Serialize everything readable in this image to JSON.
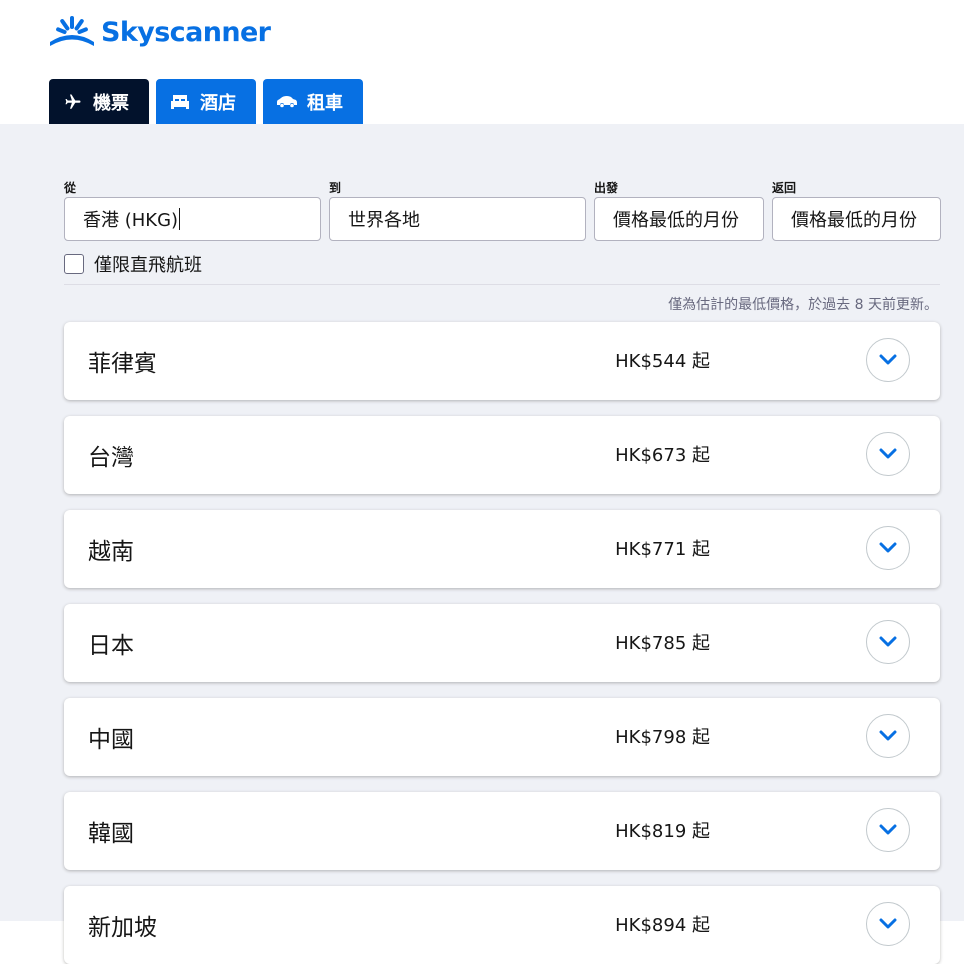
{
  "brand": {
    "name": "Skyscanner",
    "color": "#0770e3"
  },
  "tabs": [
    {
      "label": "機票",
      "icon": "airplane-icon",
      "active": true
    },
    {
      "label": "酒店",
      "icon": "bed-icon",
      "active": false
    },
    {
      "label": "租車",
      "icon": "car-icon",
      "active": false
    }
  ],
  "search": {
    "from": {
      "label": "從",
      "value": "香港 (HKG)"
    },
    "to": {
      "label": "到",
      "value": "世界各地"
    },
    "depart": {
      "label": "出發",
      "value": "價格最低的月份"
    },
    "return": {
      "label": "返回",
      "value": "價格最低的月份"
    },
    "direct_only": {
      "label": "僅限直飛航班",
      "checked": false
    }
  },
  "note": "僅為估計的最低價格，於過去 8 天前更新。",
  "destinations": [
    {
      "name": "菲律賓",
      "price": "HK$544 起"
    },
    {
      "name": "台灣",
      "price": "HK$673 起"
    },
    {
      "name": "越南",
      "price": "HK$771 起"
    },
    {
      "name": "日本",
      "price": "HK$785 起"
    },
    {
      "name": "中國",
      "price": "HK$798 起"
    },
    {
      "name": "韓國",
      "price": "HK$819 起"
    },
    {
      "name": "新加坡",
      "price": "HK$894 起"
    }
  ],
  "colors": {
    "primary": "#0770e3",
    "active_tab": "#02122c",
    "background": "#eff1f6",
    "muted_text": "#68697f"
  }
}
